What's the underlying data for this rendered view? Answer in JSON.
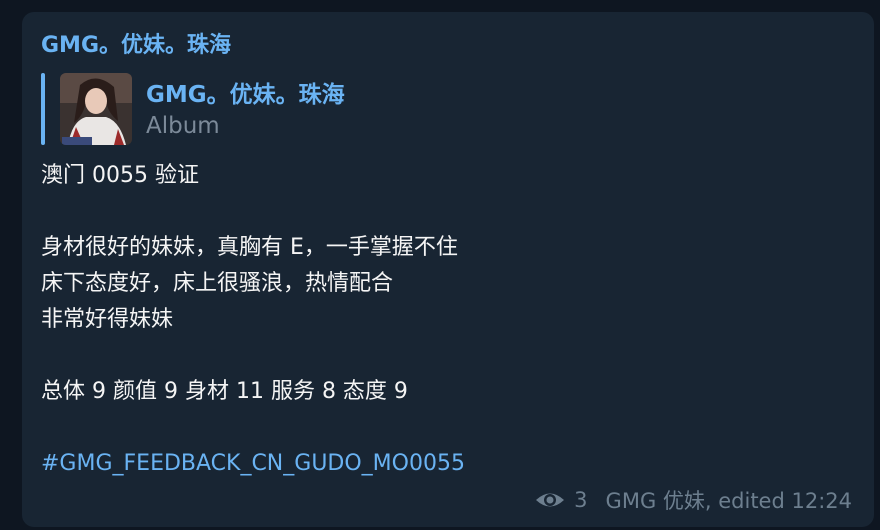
{
  "message": {
    "sender": "GMG。优妹。珠海",
    "reply": {
      "title": "GMG。优妹。珠海",
      "subtitle": "Album"
    },
    "lines": {
      "l1": "澳门 0055 验证",
      "l2": "身材很好的妹妹，真胸有 E，一手掌握不住",
      "l3": "床下态度好，床上很骚浪，热情配合",
      "l4": "非常好得妹妹",
      "l5": "总体 9 颜值 9 身材 11 服务 8 态度 9",
      "hashtag": "#GMG_FEEDBACK_CN_GUDO_MO0055"
    },
    "footer": {
      "views": "3",
      "signature": "GMG 优妹, edited 12:24",
      "views_icon": "eye-icon"
    }
  },
  "colors": {
    "background": "#0e1621",
    "bubble": "#182533",
    "accent": "#6ab3f3",
    "muted": "#6d7f8f",
    "text": "#f5f5f5"
  }
}
